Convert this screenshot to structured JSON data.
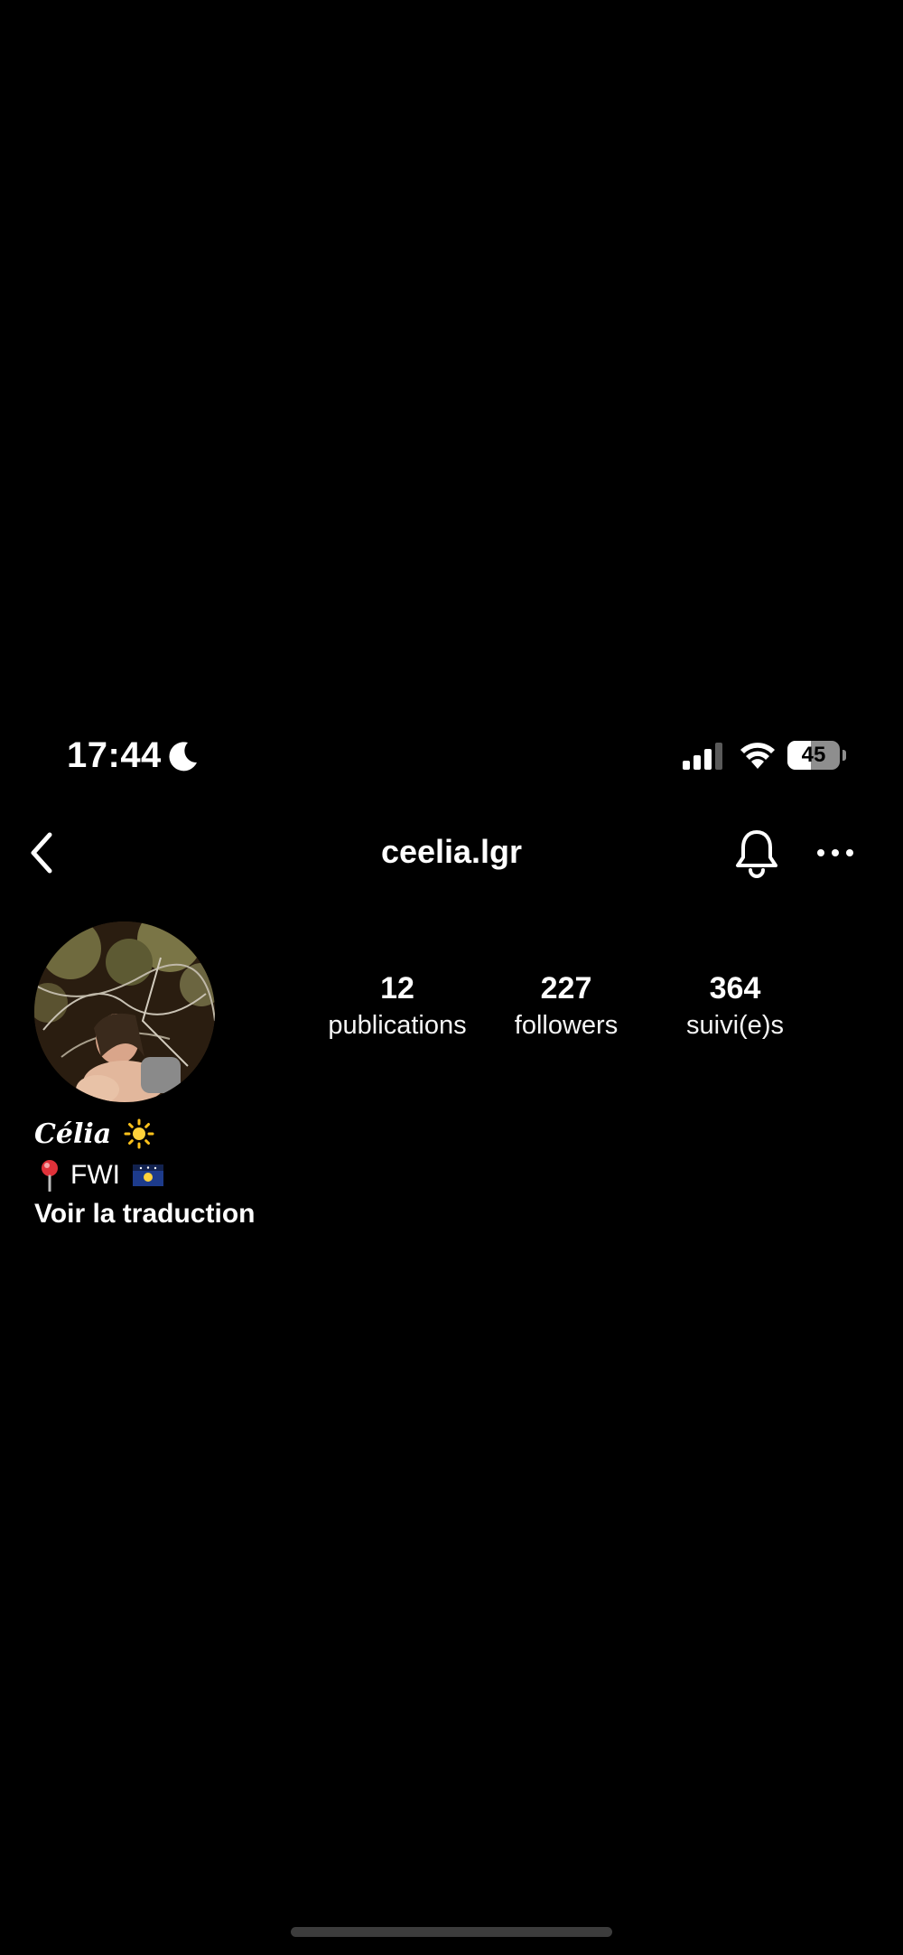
{
  "status_bar": {
    "time": "17:44",
    "battery_level": "45",
    "icons": [
      "moon-icon",
      "signal-icon",
      "wifi-icon",
      "battery-icon"
    ]
  },
  "nav": {
    "username": "ceelia.lgr",
    "icons": [
      "chevron-left-icon",
      "bell-icon",
      "more-dots-icon"
    ]
  },
  "profile": {
    "stats": [
      {
        "value": "12",
        "label": "publications"
      },
      {
        "value": "227",
        "label": "followers"
      },
      {
        "value": "364",
        "label": "suivi(e)s"
      }
    ],
    "bio": {
      "name": "Célia",
      "name_emoji": "sun-icon",
      "location_emoji": "pin-icon",
      "location": "FWI",
      "flag_emoji": "flag-icon",
      "translate_link": "Voir la traduction"
    }
  },
  "colors": {
    "background": "#000000",
    "text": "#ffffff",
    "battery_track": "#8e8e8e",
    "home_indicator": "#3c3c3c"
  }
}
